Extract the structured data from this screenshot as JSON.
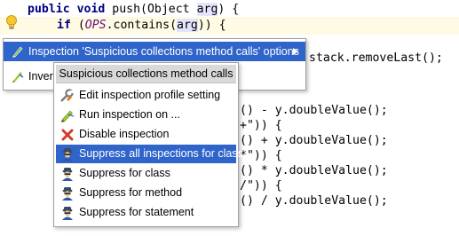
{
  "editor": {
    "line1": {
      "kw": "public void",
      "mid": " push(Object ",
      "arg": "arg",
      "end": ") {"
    },
    "line2": {
      "kw": "if",
      "open": " (",
      "static": "OPS",
      "mid": ".contains(",
      "arg": "arg",
      "end": ")) {"
    },
    "line3_tail": "stack.removeLast();",
    "line5_tail": "() - y.doubleValue();",
    "line6_tail": "+\")) {",
    "line7_tail": "() + y.doubleValue();",
    "line8_tail": "*\")) {",
    "line9_tail": "() * y.doubleValue();",
    "line10_tail": "/\")) {",
    "line11_tail": "() / y.doubleValue();"
  },
  "intention_menu": {
    "items": [
      {
        "icon": "inspection-options-icon",
        "label": "Inspection 'Suspicious collections method calls' options",
        "selected": true,
        "has_submenu": true
      },
      {
        "icon": "invert-icon",
        "label": "Inver",
        "selected": false
      }
    ]
  },
  "submenu": {
    "title": "Suspicious collections method calls",
    "items": [
      {
        "icon": "edit-profile-icon",
        "label": "Edit inspection profile setting"
      },
      {
        "icon": "run-inspection-icon",
        "label": "Run inspection on ..."
      },
      {
        "icon": "disable-icon",
        "label": "Disable inspection"
      },
      {
        "icon": "suppress-icon",
        "label": "Suppress all inspections for class",
        "selected": true
      },
      {
        "icon": "suppress-icon",
        "label": "Suppress for class"
      },
      {
        "icon": "suppress-icon",
        "label": "Suppress for method"
      },
      {
        "icon": "suppress-icon",
        "label": "Suppress for statement"
      }
    ]
  },
  "colors": {
    "selection": "#2f65ca",
    "keyword": "#000080",
    "static_field": "#660e7a",
    "current_line": "#fffae3"
  }
}
